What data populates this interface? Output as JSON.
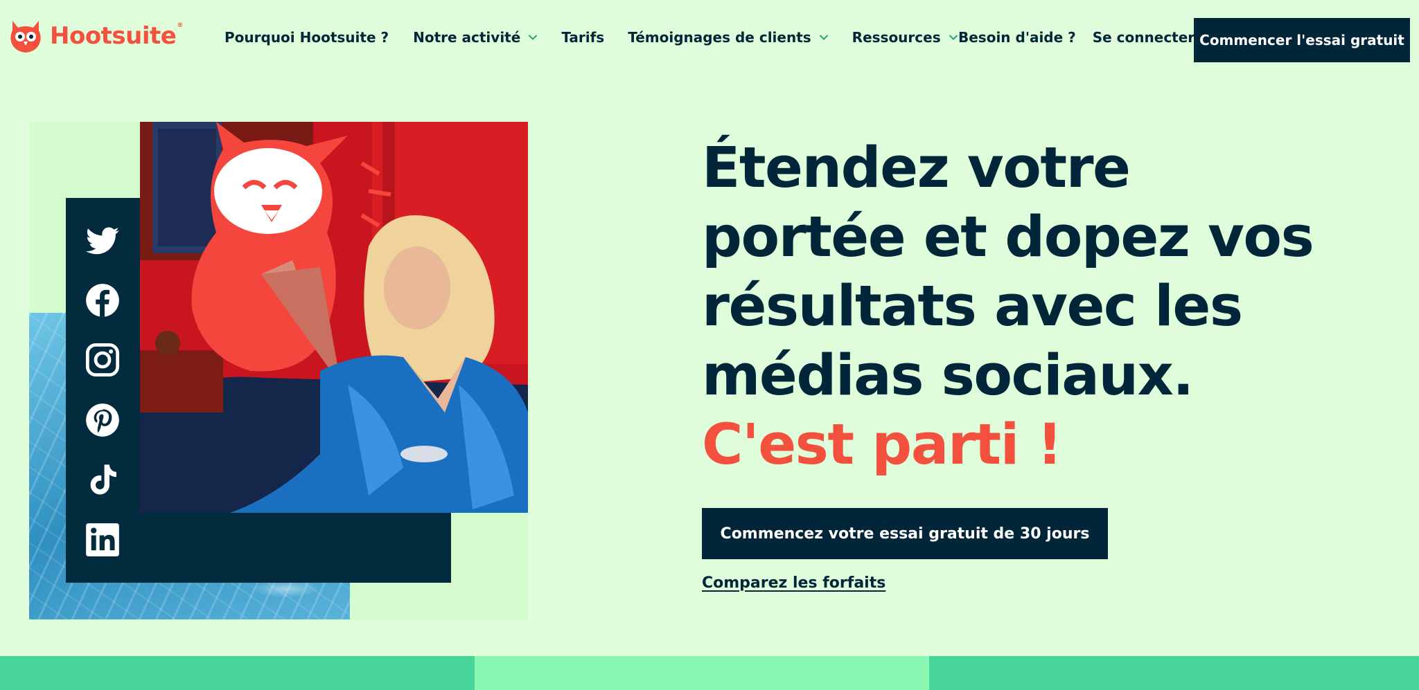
{
  "brand": {
    "name": "Hootsuite",
    "trademark": "®",
    "color": "#f4503e"
  },
  "nav": {
    "items": [
      {
        "label": "Pourquoi Hootsuite ?",
        "has_dropdown": false
      },
      {
        "label": "Notre activité",
        "has_dropdown": true
      },
      {
        "label": "Tarifs",
        "has_dropdown": false
      },
      {
        "label": "Témoignages de clients",
        "has_dropdown": true
      },
      {
        "label": "Ressources",
        "has_dropdown": true
      }
    ],
    "help_label": "Besoin d'aide ?",
    "login_label": "Se connecter",
    "cta_label": "Commencer l'essai gratuit"
  },
  "hero": {
    "headline_lines": [
      "Étendez votre",
      "portée et dopez vos",
      "résultats avec les",
      "médias sociaux."
    ],
    "headline_accent": "C'est parti !",
    "cta_label": "Commencez votre essai gratuit de 30 jours",
    "compare_link": "Comparez les forfaits"
  },
  "social_icons": [
    "twitter-icon",
    "facebook-icon",
    "instagram-icon",
    "pinterest-icon",
    "tiktok-icon",
    "linkedin-icon"
  ],
  "colors": {
    "background": "#dffddb",
    "navy": "#012639",
    "accent": "#f4503e",
    "strip_green": "#47d59a",
    "strip_light": "#8af7b2"
  }
}
